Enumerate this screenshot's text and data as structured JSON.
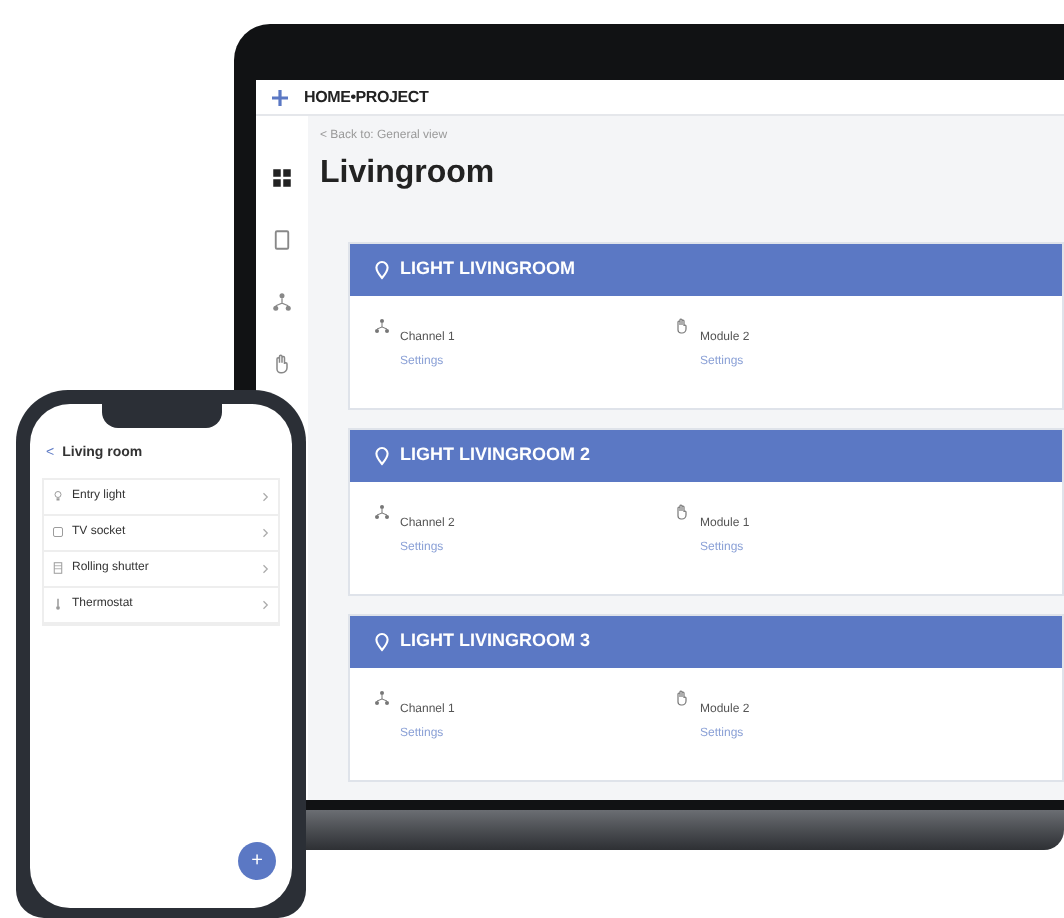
{
  "laptop": {
    "app": {
      "logo": "HOME•PROJECT",
      "nav": [
        {
          "selected": true
        },
        {
          "selected": false
        },
        {
          "selected": false
        },
        {
          "selected": false
        }
      ],
      "back_link": "< Back to: General view",
      "title": "Livingroom",
      "cards": [
        {
          "title": "LIGHT LIVINGROOM",
          "items": [
            {
              "name": "Channel 1",
              "links": [
                "Settings"
              ]
            },
            {
              "name": "Module 2",
              "links": [
                "Settings"
              ]
            }
          ]
        },
        {
          "title": "LIGHT LIVINGROOM 2",
          "items": [
            {
              "name": "Channel 2",
              "links": [
                "Settings"
              ]
            },
            {
              "name": "Module 1",
              "links": [
                "Settings"
              ]
            }
          ]
        },
        {
          "title": "LIGHT LIVINGROOM 3",
          "items": [
            {
              "name": "Channel 1",
              "links": [
                "Settings"
              ]
            },
            {
              "name": "Module 2",
              "links": [
                "Settings"
              ]
            }
          ]
        }
      ]
    }
  },
  "phone": {
    "back": "<",
    "title": "Living room",
    "rows": [
      {
        "label": "Entry light"
      },
      {
        "label": "TV socket"
      },
      {
        "label": "Rolling shutter"
      },
      {
        "label": "Thermostat"
      }
    ],
    "fab": "+"
  }
}
